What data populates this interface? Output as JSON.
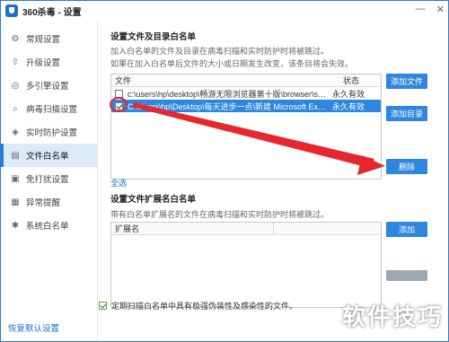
{
  "window": {
    "title": "360杀毒 - 设置"
  },
  "sidebar": {
    "items": [
      {
        "label": "常规设置",
        "icon": "gear-icon"
      },
      {
        "label": "升级设置",
        "icon": "upgrade-icon"
      },
      {
        "label": "多引擎设置",
        "icon": "engine-icon"
      },
      {
        "label": "病毒扫描设置",
        "icon": "search-icon"
      },
      {
        "label": "实时防护设置",
        "icon": "shield-icon"
      },
      {
        "label": "文件白名单",
        "icon": "document-icon"
      },
      {
        "label": "免打扰设置",
        "icon": "do-not-disturb-icon"
      },
      {
        "label": "异常提醒",
        "icon": "alert-icon"
      },
      {
        "label": "系统白名单",
        "icon": "system-whitelist-icon"
      }
    ],
    "active_index": 5,
    "restore_label": "恢复默认设置"
  },
  "whitelist": {
    "title": "设置文件及目录白名单",
    "desc_line1": "加入白名单的文件及目录在病毒扫描和实时防护时将被跳过。",
    "desc_line2": "如果在加入白名单后文件的大小或日期发生改变，该条目将会失效。",
    "col_file": "文件",
    "col_status": "状态",
    "rows": [
      {
        "checked": false,
        "path": "c:\\users\\hp\\desktop\\畅游无限浏览器第十版\\browser\\sy...",
        "status": "永久有效",
        "selected": false
      },
      {
        "checked": true,
        "path": "C:\\Users\\hp\\Desktop\\每天进步一点\\新建 Microsoft Exc...",
        "status": "永久有效",
        "selected": true
      }
    ],
    "add_file_label": "添加文件",
    "add_dir_label": "添加目录",
    "delete_label": "删除",
    "select_all_label": "全选"
  },
  "extension": {
    "title": "设置文件扩展名白名单",
    "desc": "带有白名单扩展名的文件在病毒扫描和实时防护时将被跳过。",
    "col_ext": "扩展名",
    "add_label": "添加"
  },
  "periodic_scan": {
    "checked": true,
    "label": "定期扫描白名单中具有极强伪装性及感染性的文件。"
  },
  "watermark": "软件技巧",
  "colors": {
    "accent": "#2e86de",
    "arrow": "#e8262d"
  }
}
